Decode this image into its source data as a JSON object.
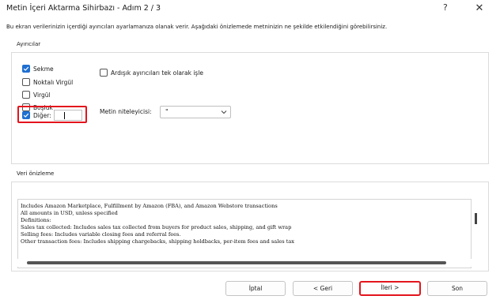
{
  "window": {
    "title": "Metin İçeri Aktarma Sihirbazı - Adım 2 / 3",
    "help_glyph": "?",
    "close_glyph": "✕"
  },
  "instructions": "Bu ekran verilerinizin içerdiği ayırıcıları ayarlamanıza olanak verir. Aşağıdaki önizlemede metninizin ne şekilde etkilendiğini görebilirsiniz.",
  "separators": {
    "group_label": "Ayırıcılar",
    "items": [
      {
        "label": "Sekme",
        "checked": true
      },
      {
        "label": "Noktalı Virgül",
        "checked": false
      },
      {
        "label": "Virgül",
        "checked": false
      },
      {
        "label": "Boşluk",
        "checked": false
      },
      {
        "label": "Diğer:",
        "checked": true
      }
    ],
    "other_value": "",
    "consecutive_label": "Ardışık ayırıcıları tek olarak işle",
    "consecutive_checked": false,
    "qualifier_label": "Metin niteleyicisi:",
    "qualifier_value": "\""
  },
  "preview": {
    "group_label": "Veri önizleme",
    "lines": [
      "Includes Amazon Marketplace, Fulfillment by Amazon (FBA), and Amazon Webstore transactions",
      "All amounts in USD, unless specified",
      "Definitions:",
      "Sales tax collected: Includes sales tax collected from buyers for product sales, shipping, and gift wrap",
      "Selling fees: Includes variable closing fees and referral fees.",
      "Other transaction fees: Includes shipping chargebacks, shipping holdbacks, per-item fees  and sales tax"
    ]
  },
  "buttons": {
    "cancel": "İptal",
    "back": "< Geri",
    "next": "İleri >",
    "finish": "Son"
  },
  "colors": {
    "accent": "#1f6fd1",
    "highlight": "#e3141c"
  }
}
